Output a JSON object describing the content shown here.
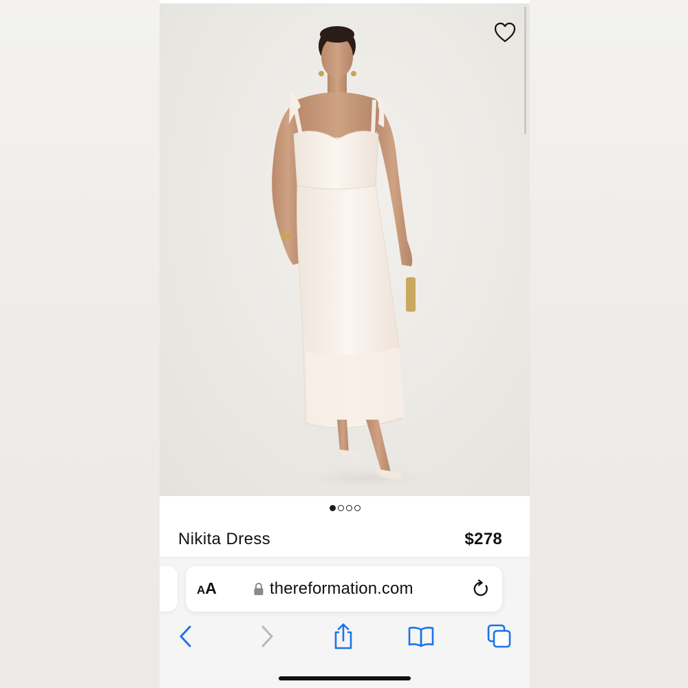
{
  "product": {
    "name": "Nikita Dress",
    "price": "$278",
    "image_icon": "product-photo-white-midi-dress",
    "carousel": {
      "total": 4,
      "active_index": 0
    }
  },
  "browser": {
    "text_size_label_small": "A",
    "text_size_label_big": "A",
    "url": "thereformation.com"
  },
  "icons": {
    "wishlist": "heart-icon",
    "lock": "lock-icon",
    "reload": "reload-icon",
    "back": "chevron-left-icon",
    "forward": "chevron-right-icon",
    "share": "share-icon",
    "bookmarks": "book-icon",
    "tabs": "tabs-icon"
  },
  "colors": {
    "accent": "#1a73e8",
    "disabled": "#b8b8b8",
    "text": "#111111"
  }
}
